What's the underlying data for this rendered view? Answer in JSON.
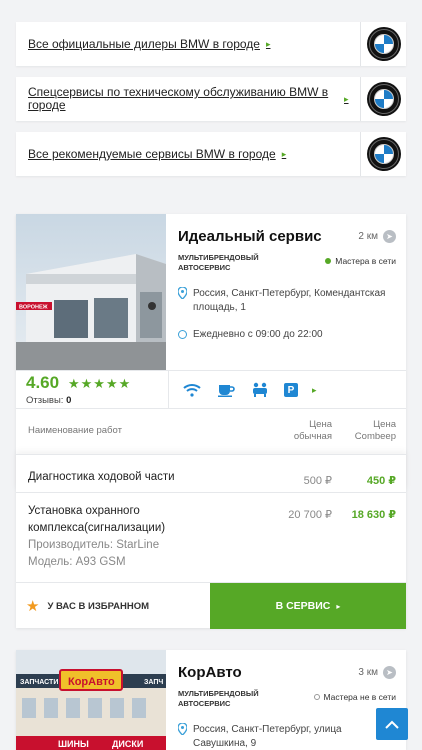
{
  "links": [
    {
      "label": "Все официальные дилеры BMW в городе"
    },
    {
      "label": "Спецсервисы по техническому обслуживанию BMW в городе"
    },
    {
      "label": "Все рекомендуемые сервисы BMW в городе"
    }
  ],
  "services": [
    {
      "title": "Идеальный сервис",
      "type": "Мультибрендовый автосервис",
      "distance": "2 км",
      "status": "Мастера в сети",
      "address": "Россия, Санкт-Петербург, Комендантская площадь, 1",
      "hours": "Ежедневно с 09:00 до 22:00",
      "rating": "4.60",
      "stars": 5,
      "reviews_label": "Отзывы:",
      "reviews_count": "0",
      "sign_text": "ВОРОНЕЖ"
    },
    {
      "title": "КорАвто",
      "type": "Мультибрендовый автосервис",
      "distance": "3 км",
      "status": "Мастера не в сети",
      "address": "Россия, Санкт-Петербург, улица Савушкина, 9",
      "sign_text": "КорАвто",
      "banner_left": "ЗАПЧАСТИ",
      "banner_right": "ЗАПЧ",
      "bottom_left": "ШИНЫ",
      "bottom_right": "ДИСКИ"
    }
  ],
  "prices": {
    "col_name": "Наименование работ",
    "col_regular": "Цена обычная",
    "col_combeer": "Цена Combeep",
    "rows": [
      {
        "name": "Диагностика ходовой части",
        "regular": "500 ₽",
        "combeer": "450 ₽"
      },
      {
        "name": "Установка охранного комплекса(сигнализации)",
        "sub1": "Производитель: StarLine",
        "sub2": "Модель: A93 GSM",
        "regular": "20 700 ₽",
        "combeer": "18 630 ₽"
      }
    ]
  },
  "footer": {
    "favorite_label": "У ВАС В ИЗБРАННОМ",
    "go_label": "В СЕРВИС"
  },
  "colors": {
    "accent_green": "#56a826",
    "accent_blue": "#1f87d3",
    "star_orange": "#f29a1f"
  }
}
